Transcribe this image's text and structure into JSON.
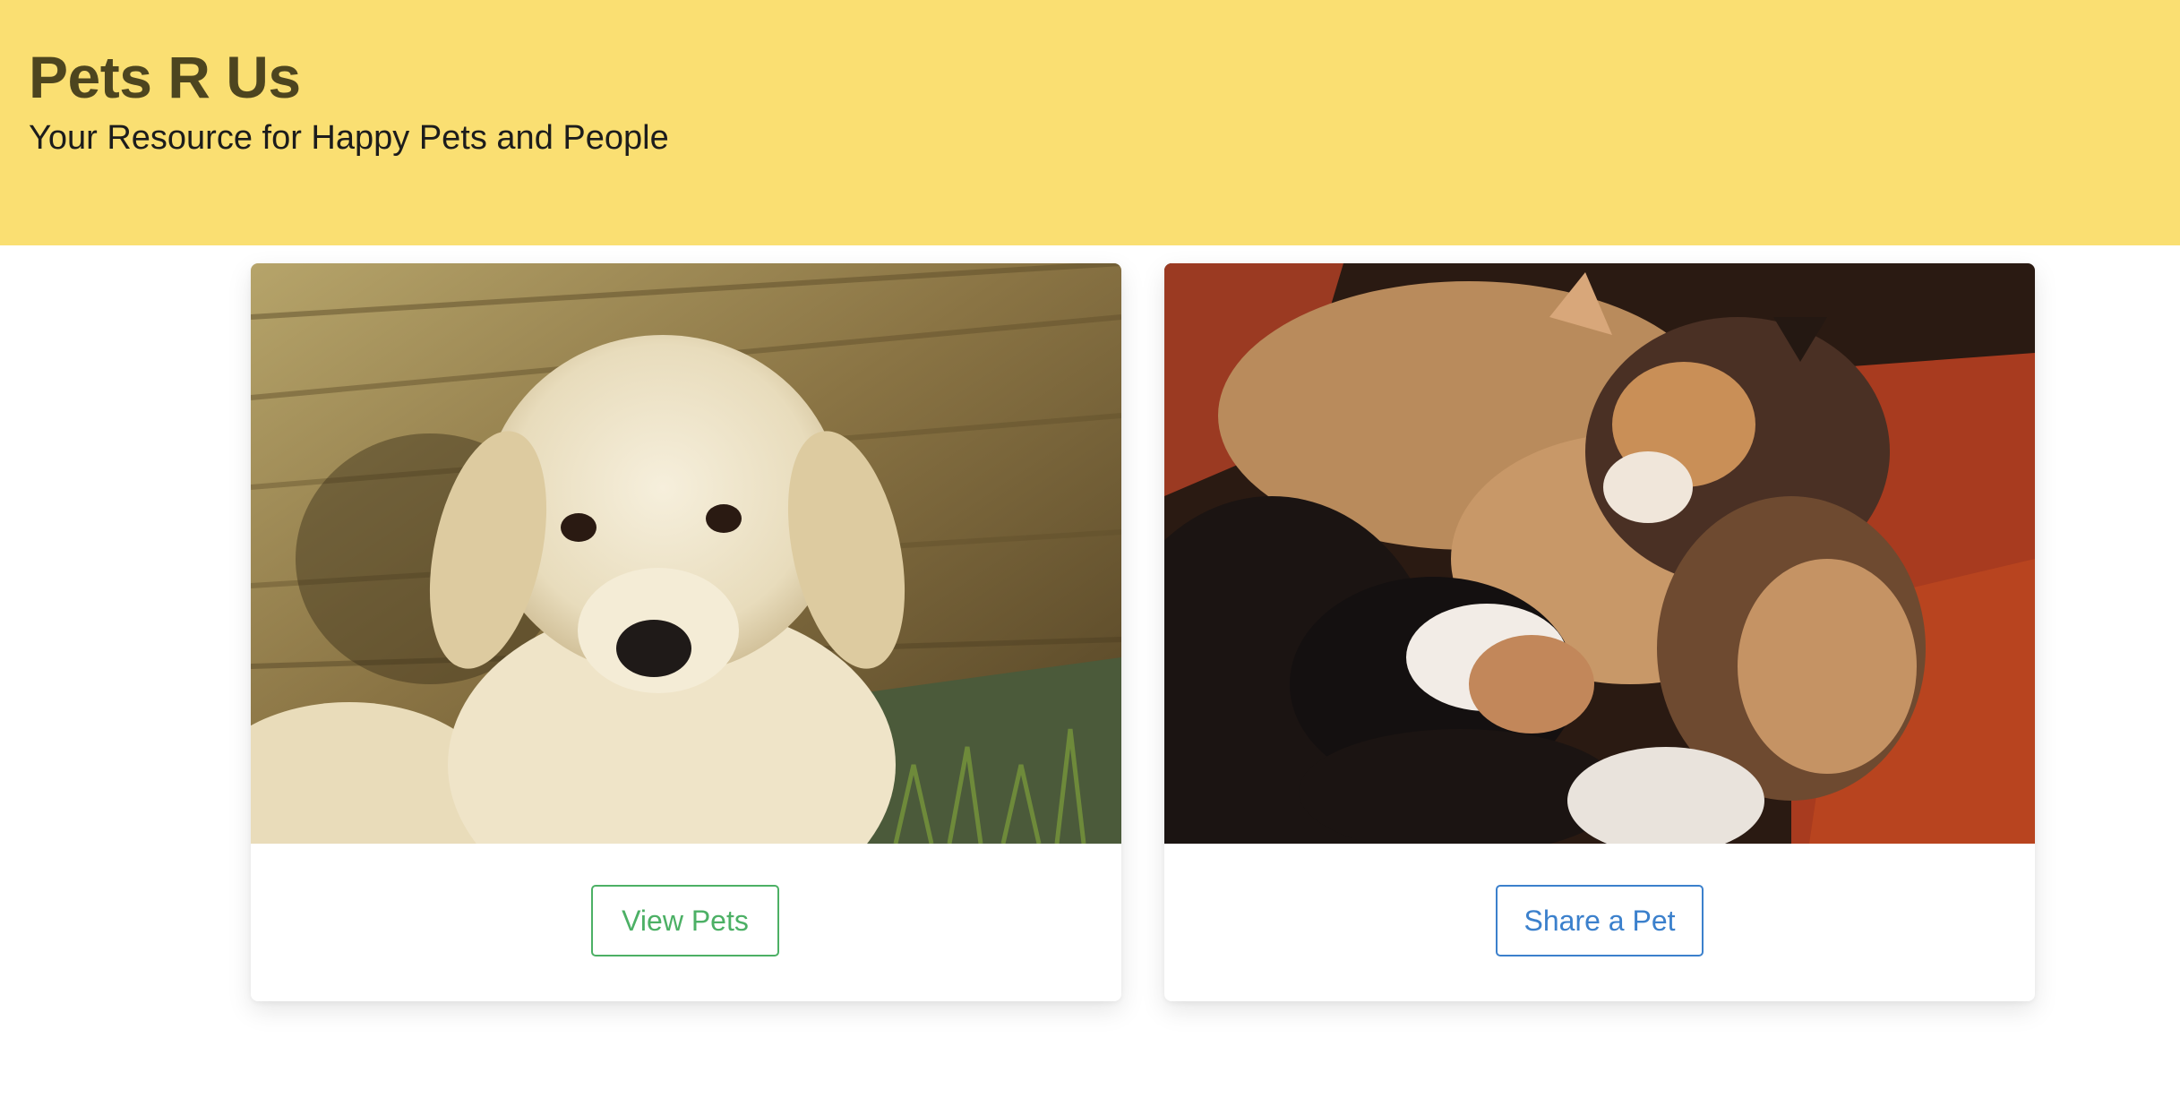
{
  "header": {
    "title": "Pets R Us",
    "subtitle": "Your Resource for Happy Pets and People",
    "background_color": "#fadf72"
  },
  "cards": [
    {
      "image": "golden-retriever-puppy-photo",
      "button_label": "View Pets",
      "button_color": "#4cb065"
    },
    {
      "image": "calico-kittens-photo",
      "button_label": "Share a Pet",
      "button_color": "#3b80cc"
    }
  ]
}
